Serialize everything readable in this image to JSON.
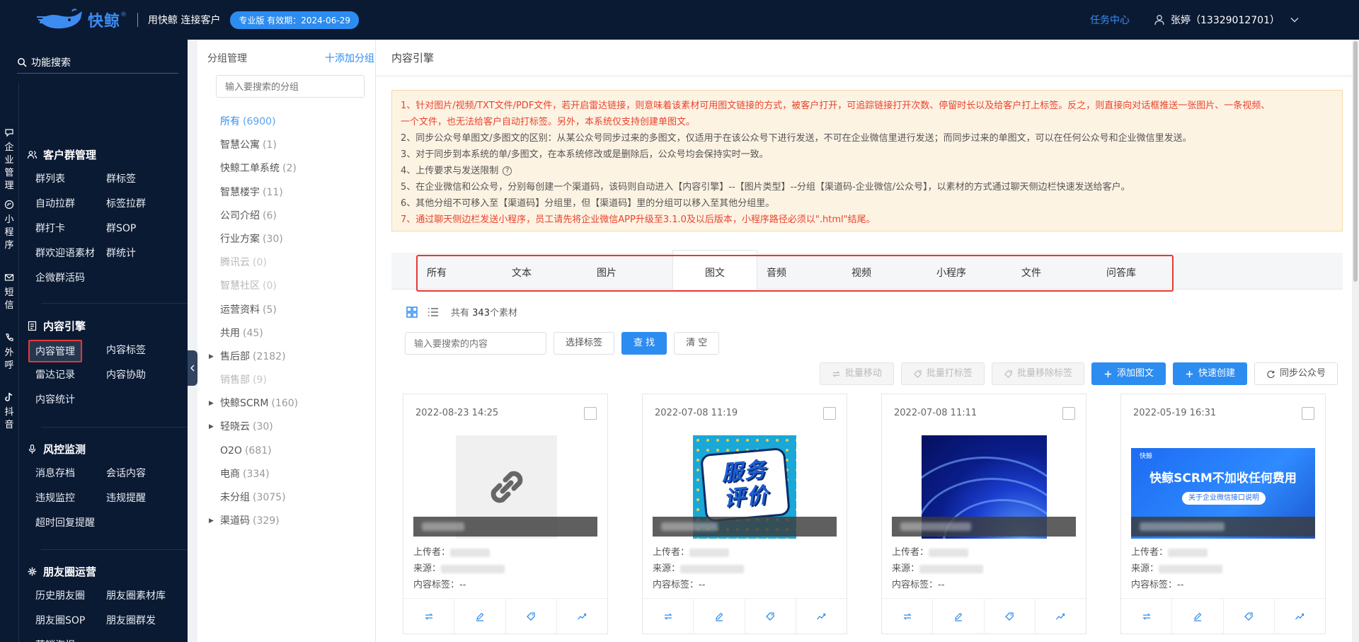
{
  "header": {
    "brand": "快鲸",
    "registered_mark": "®",
    "slogan": "用快鲸 连接客户",
    "badge": "专业版 有效期：2024-06-29",
    "task_center": "任务中心",
    "user": "张婷（13329012701）"
  },
  "sidebar": {
    "search_label": "功能搜索",
    "rail": [
      {
        "label": "企业管理",
        "icon": "chat-bubble-icon"
      },
      {
        "label": "小程序",
        "icon": "miniprogram-icon"
      },
      {
        "label": "短信",
        "icon": "mail-icon"
      },
      {
        "label": "外呼",
        "icon": "phone-icon"
      },
      {
        "label": "抖音",
        "icon": "douyin-icon"
      }
    ],
    "groups": [
      {
        "title": "客户群管理",
        "icon": "group-icon",
        "items": [
          "群列表",
          "群标签",
          "自动拉群",
          "标签拉群",
          "群打卡",
          "群SOP",
          "群欢迎语素材",
          "群统计",
          "企微群活码"
        ]
      },
      {
        "title": "内容引擎",
        "icon": "document-icon",
        "items": [
          "内容管理",
          "内容标签",
          "雷达记录",
          "内容协助",
          "内容统计"
        ],
        "active": "内容管理"
      },
      {
        "title": "风控监测",
        "icon": "microphone-icon",
        "items": [
          "消息存档",
          "会话内容",
          "违规监控",
          "违规提醒",
          "超时回复提醒"
        ]
      },
      {
        "title": "朋友圈运营",
        "icon": "moments-icon",
        "items": [
          "历史朋友圈",
          "朋友圈素材库",
          "朋友圈SOP",
          "朋友圈群发",
          "营销海报"
        ]
      }
    ]
  },
  "group_panel": {
    "title": "分组管理",
    "add_label": "十添加分组",
    "search_placeholder": "输入要搜索的分组",
    "items": [
      {
        "name": "所有",
        "count": "(6900)",
        "state": "active",
        "expand": false
      },
      {
        "name": "智慧公寓",
        "count": "(1)",
        "state": "normal",
        "expand": false
      },
      {
        "name": "快鲸工单系统",
        "count": "(2)",
        "state": "normal",
        "expand": false
      },
      {
        "name": "智慧楼宇",
        "count": "(11)",
        "state": "normal",
        "expand": false
      },
      {
        "name": "公司介绍",
        "count": "(6)",
        "state": "normal",
        "expand": false
      },
      {
        "name": "行业方案",
        "count": "(30)",
        "state": "normal",
        "expand": false
      },
      {
        "name": "腾讯云",
        "count": "(0)",
        "state": "muted",
        "expand": false
      },
      {
        "name": "智慧社区",
        "count": "(0)",
        "state": "muted",
        "expand": false
      },
      {
        "name": "运营资料",
        "count": "(5)",
        "state": "normal",
        "expand": false
      },
      {
        "name": "共用",
        "count": "(45)",
        "state": "normal",
        "expand": false
      },
      {
        "name": "售后部",
        "count": "(2182)",
        "state": "normal",
        "expand": true
      },
      {
        "name": "销售部",
        "count": "(9)",
        "state": "muted",
        "expand": false
      },
      {
        "name": "快鲸SCRM",
        "count": "(160)",
        "state": "normal",
        "expand": true
      },
      {
        "name": "轻晓云",
        "count": "(30)",
        "state": "normal",
        "expand": true
      },
      {
        "name": "O2O",
        "count": "(681)",
        "state": "normal",
        "expand": false
      },
      {
        "name": "电商",
        "count": "(334)",
        "state": "normal",
        "expand": false
      },
      {
        "name": "未分组",
        "count": "(3075)",
        "state": "normal",
        "expand": false
      },
      {
        "name": "渠道码",
        "count": "(329)",
        "state": "normal",
        "expand": true
      }
    ]
  },
  "main": {
    "title": "内容引擎",
    "notice": [
      {
        "text": "1、针对图片/视频/TXT文件/PDF文件，若开启雷达链接，则意味着该素材可用图文链接的方式，被客户打开，可追踪链接打开次数、停留时长以及给客户打上标签。反之，则直接向对话框推送一张图片、一条视频、",
        "red": true
      },
      {
        "text": "一个文件，也无法给客户自动打标签。另外，本系统仅支持创建单图文。",
        "red": true
      },
      {
        "text": "2、同步公众号单图文/多图文的区别：从某公众号同步过来的多图文，仅适用于在该公众号下进行发送，不可在企业微信里进行发送；而同步过来的单图文，可以在任何公众号和企业微信里发送。",
        "red": false
      },
      {
        "text": "3、对于同步到本系统的单/多图文，在本系统修改或是删除后，公众号均会保持实时一致。",
        "red": false
      },
      {
        "text": "4、上传要求与发送限制",
        "red": false,
        "help": "?"
      },
      {
        "text": "5、在企业微信和公众号，分别每创建一个渠道码，该码则自动进入【内容引擎】--【图片类型】--分组【渠道码-企业微信/公众号】，以素材的方式通过聊天侧边栏快速发送给客户。",
        "red": false
      },
      {
        "text": "6、其他分组不可移入至【渠道码】分组里，但【渠道码】里的分组可以移入至其他分组里。",
        "red": false
      },
      {
        "text": "7、通过聊天侧边栏发送小程序，员工请先将企业微信APP升级至3.1.0及以后版本，小程序路径必须以\".html\"结尾。",
        "red": true
      }
    ],
    "tabs": [
      "所有",
      "文本",
      "图片",
      "图文",
      "音频",
      "视频",
      "小程序",
      "文件",
      "问答库"
    ],
    "active_tab": "图文",
    "total_prefix": "共有",
    "total_count": "343",
    "total_suffix": "个素材",
    "search_placeholder": "输入要搜索的内容",
    "select_tag": "选择标签",
    "search_btn": "查 找",
    "clear_btn": "清 空",
    "actions": [
      {
        "label": "批量移动",
        "icon": "move-icon",
        "style": "disabled"
      },
      {
        "label": "批量打标签",
        "icon": "tag-icon",
        "style": "disabled"
      },
      {
        "label": "批量移除标签",
        "icon": "tag-icon",
        "style": "disabled"
      },
      {
        "label": "添加图文",
        "icon": "plus-icon",
        "style": "primary"
      },
      {
        "label": "快速创建",
        "icon": "plus-icon",
        "style": "primary"
      },
      {
        "label": "同步公众号",
        "icon": "refresh-icon",
        "style": "default"
      }
    ],
    "cards": [
      {
        "date": "2022-08-23 14:25",
        "thumb": "link",
        "uploader_label": "上传者：",
        "source_label": "来源：",
        "tags_label": "内容标签：",
        "tags_value": "--"
      },
      {
        "date": "2022-07-08 11:19",
        "thumb": "eval",
        "thumb_text": [
          "服务",
          "评价"
        ],
        "uploader_label": "上传者：",
        "source_label": "来源：",
        "tags_label": "内容标签：",
        "tags_value": "--"
      },
      {
        "date": "2022-07-08 11:11",
        "thumb": "win",
        "uploader_label": "上传者：",
        "source_label": "来源：",
        "tags_label": "内容标签：",
        "tags_value": "--"
      },
      {
        "date": "2022-05-19 16:31",
        "thumb": "scrm",
        "thumb_logo": "快鲸",
        "thumb_title": "快鲸SCRM不加收任何费用",
        "thumb_sub": "关于企业微信接口说明",
        "uploader_label": "上传者：",
        "source_label": "来源：",
        "tags_label": "内容标签：",
        "tags_value": "--"
      }
    ],
    "card_ops": [
      "move-icon",
      "edit-icon",
      "tag-icon",
      "chart-icon"
    ]
  },
  "colors": {
    "primary": "#2d8cf0",
    "nav_bg": "#0b1a33",
    "highlight_red": "#e53935",
    "notice_bg": "#fdf3e3",
    "notice_red": "#e8442d"
  }
}
